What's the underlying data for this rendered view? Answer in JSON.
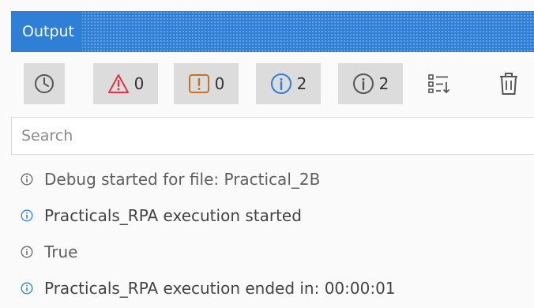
{
  "panel": {
    "title": "Output"
  },
  "toolbar": {
    "timestamp_icon": "clock-icon",
    "errors": {
      "icon": "warning-triangle-icon",
      "count": "0",
      "color": "#e0353f"
    },
    "warnings": {
      "icon": "exclamation-box-icon",
      "count": "0",
      "color": "#c0752a"
    },
    "info": {
      "icon": "info-circle-icon",
      "count": "2",
      "color": "#2f7fd6"
    },
    "trace": {
      "icon": "info-circle-icon",
      "count": "2",
      "color": "#555555"
    },
    "collapse_icon": "list-collapse-icon",
    "clear_icon": "trash-icon"
  },
  "search": {
    "placeholder": "Search",
    "value": ""
  },
  "log": [
    {
      "level": "trace",
      "text": "Debug started for file: Practical_2B"
    },
    {
      "level": "info",
      "text": "Practicals_RPA execution started"
    },
    {
      "level": "trace",
      "text": "True"
    },
    {
      "level": "info",
      "text": "Practicals_RPA execution ended in: 00:00:01"
    }
  ],
  "colors": {
    "accent": "#2f7fd6",
    "error": "#e0353f",
    "warning": "#c0752a",
    "trace": "#555555"
  }
}
